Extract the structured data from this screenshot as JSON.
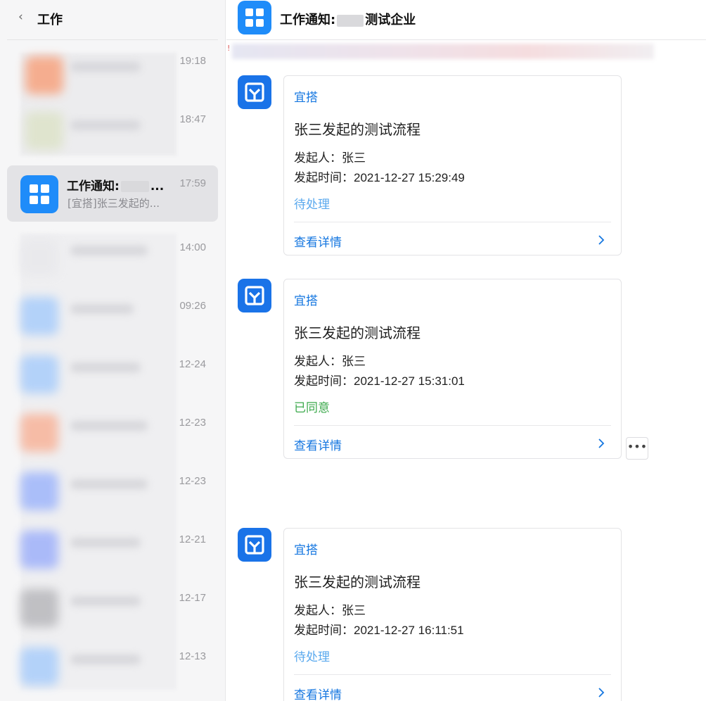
{
  "sidebar": {
    "back_icon": "chevron-left-icon",
    "title": "工作",
    "conversations": [
      {
        "time": "19:18"
      },
      {
        "time": "18:47"
      },
      {
        "time": "17:59",
        "selected": true,
        "name_prefix": "工作通知:",
        "name_suffix": "...",
        "preview": "[宜搭]张三发起的..."
      },
      {
        "time": "14:00"
      },
      {
        "time": "09:26"
      },
      {
        "time": "12-24"
      },
      {
        "time": "12-23"
      },
      {
        "time": "12-23"
      },
      {
        "time": "12-21"
      },
      {
        "time": "12-17"
      },
      {
        "time": "12-13"
      }
    ]
  },
  "chat": {
    "title_prefix": "工作通知:",
    "title_suffix": "测试企业",
    "notice_mark": "!",
    "messages": [
      {
        "app": "宜搭",
        "title": "张三发起的测试流程",
        "initiator_label": "发起人：",
        "initiator": "张三",
        "time_label": "发起时间：",
        "time": "2021-12-27 15:29:49",
        "status": "待处理",
        "status_color": "#5aa9ee",
        "link": "查看详情"
      },
      {
        "app": "宜搭",
        "title": "张三发起的测试流程",
        "initiator_label": "发起人：",
        "initiator": "张三",
        "time_label": "发起时间：",
        "time": "2021-12-27 15:31:01",
        "status": "已同意",
        "status_color": "#3daa4d",
        "link": "查看详情"
      },
      {
        "app": "宜搭",
        "title": "张三发起的测试流程",
        "initiator_label": "发起人：",
        "initiator": "张三",
        "time_label": "发起时间：",
        "time": "2021-12-27 16:11:51",
        "status": "待处理",
        "status_color": "#5aa9ee",
        "link": "查看详情"
      }
    ],
    "more_button": "•••"
  },
  "colors": {
    "accent": "#1677e0",
    "app_blue": "#1f8cf9",
    "yida_blue": "#1a73e8"
  }
}
